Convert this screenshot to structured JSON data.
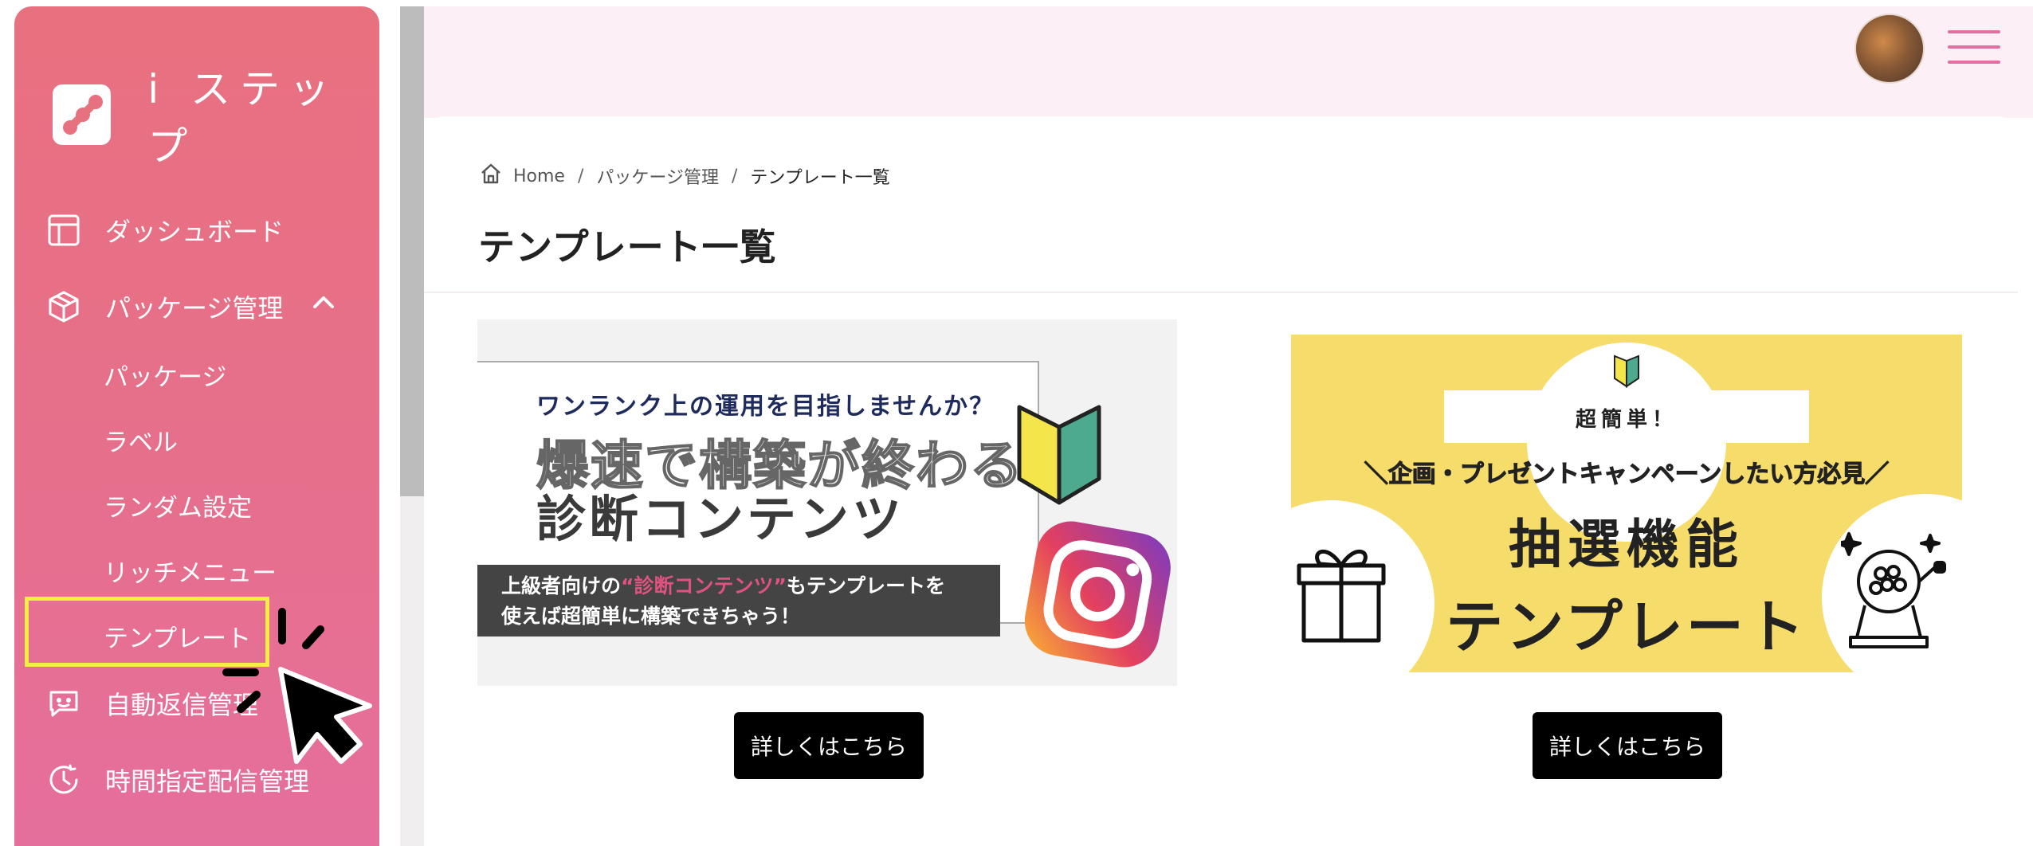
{
  "app": {
    "name": "i ステップ"
  },
  "sidebar": {
    "dashboard": "ダッシュボード",
    "package_mgmt": "パッケージ管理",
    "sub_items": [
      "パッケージ",
      "ラベル",
      "ランダム設定",
      "リッチメニュー",
      "テンプレート"
    ],
    "auto_reply": "自動返信管理",
    "scheduled": "時間指定配信管理"
  },
  "breadcrumb": {
    "home": "Home",
    "sep": "/",
    "level2": "パッケージ管理",
    "current": "テンプレート一覧"
  },
  "page": {
    "title": "テンプレート一覧"
  },
  "templates": [
    {
      "banner_line1": "ワンランク上の運用を目指しませんか？",
      "banner_line2": "爆速で構築が終わる",
      "banner_line3": "診断コンテンツ",
      "banner_note_a": "上級者向けの",
      "banner_note_pink": "“診断コンテンツ”",
      "banner_note_b": "もテンプレートを",
      "banner_note_c": "使えば超簡単に構築できちゃう！",
      "button": "詳しくはこちら"
    },
    {
      "banner_easy": "超簡単！",
      "banner_campaign": "＼企画・プレゼントキャンペーンしたい方必見／",
      "banner_title1": "抽選機能",
      "banner_title2": "テンプレート",
      "button": "詳しくはこちら"
    }
  ],
  "colors": {
    "sidebar": "#e8717f",
    "highlight": "#f6ee40",
    "accent_pink": "#e0527f",
    "banner_yellow": "#f5dc6b"
  },
  "icons": [
    "app-logo-icon",
    "dashboard-icon",
    "package-icon",
    "chevron-up-icon",
    "chat-bot-icon",
    "clock-icon",
    "home-icon",
    "menu-icon",
    "beginner-mark-icon",
    "instagram-icon",
    "gift-icon",
    "lottery-machine-icon",
    "cursor-icon"
  ]
}
